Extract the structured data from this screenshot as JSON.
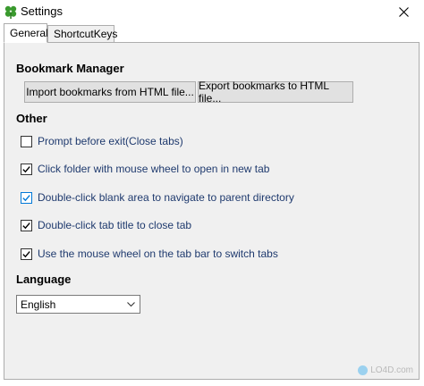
{
  "window": {
    "title": "Settings",
    "icon": "clover-icon"
  },
  "tabs": [
    {
      "label": "General",
      "active": true
    },
    {
      "label": "ShortcutKeys",
      "active": false
    }
  ],
  "bookmark_manager": {
    "title": "Bookmark Manager",
    "import_label": "Import bookmarks from HTML file...",
    "export_label": "Export bookmarks to HTML file..."
  },
  "other": {
    "title": "Other",
    "options": [
      {
        "label": "Prompt before exit(Close tabs)",
        "checked": false
      },
      {
        "label": "Click folder with mouse wheel to open in new tab",
        "checked": true
      },
      {
        "label": "Double-click blank area to navigate to parent directory",
        "checked": true
      },
      {
        "label": "Double-click tab title to close tab",
        "checked": true
      },
      {
        "label": "Use the mouse wheel on the tab bar to switch tabs",
        "checked": true
      }
    ]
  },
  "language": {
    "title": "Language",
    "selected": "English"
  },
  "watermark": "LO4D.com",
  "colors": {
    "accent": "#0078d7",
    "label_text": "#1f3a6e",
    "panel_bg": "#f0f0f0"
  }
}
